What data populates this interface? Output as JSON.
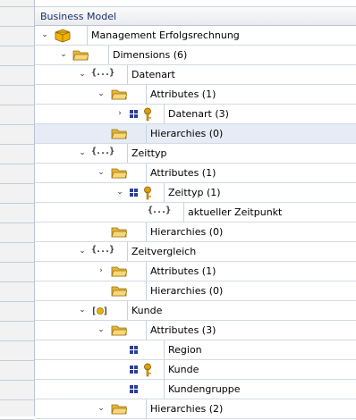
{
  "header": {
    "title": "Business Model"
  },
  "tree": [
    {
      "label": "Management Erfolgsrechnung",
      "icon": "cube-icon",
      "toggle": "expanded",
      "selected": false
    },
    {
      "label": "Dimensions (6)",
      "icon": "folder-icon",
      "toggle": "expanded",
      "selected": false
    },
    {
      "label": "Datenart",
      "icon": "dimension-icon",
      "toggle": "expanded",
      "selected": false
    },
    {
      "label": "Attributes (1)",
      "icon": "folder-icon",
      "toggle": "expanded",
      "selected": false
    },
    {
      "label": "Datenart (3)",
      "icon": "key-attribute-icon",
      "toggle": "collapsed",
      "selected": false
    },
    {
      "label": "Hierarchies (0)",
      "icon": "folder-icon",
      "toggle": "none",
      "selected": true
    },
    {
      "label": "Zeittyp",
      "icon": "dimension-icon",
      "toggle": "expanded",
      "selected": false
    },
    {
      "label": "Attributes (1)",
      "icon": "folder-icon",
      "toggle": "expanded",
      "selected": false
    },
    {
      "label": "Zeittyp (1)",
      "icon": "key-attribute-icon",
      "toggle": "expanded",
      "selected": false
    },
    {
      "label": "aktueller Zeitpunkt",
      "icon": "dimension-icon",
      "toggle": "none",
      "selected": false
    },
    {
      "label": "Hierarchies (0)",
      "icon": "folder-icon",
      "toggle": "none",
      "selected": false
    },
    {
      "label": "Zeitvergleich",
      "icon": "dimension-icon",
      "toggle": "expanded",
      "selected": false
    },
    {
      "label": "Attributes (1)",
      "icon": "folder-icon",
      "toggle": "collapsed",
      "selected": false
    },
    {
      "label": "Hierarchies (0)",
      "icon": "folder-icon",
      "toggle": "none",
      "selected": false
    },
    {
      "label": "Kunde",
      "icon": "dimension-star-icon",
      "toggle": "expanded",
      "selected": false
    },
    {
      "label": "Attributes (3)",
      "icon": "folder-icon",
      "toggle": "expanded",
      "selected": false
    },
    {
      "label": "Region",
      "icon": "attribute-icon",
      "toggle": "none",
      "selected": false
    },
    {
      "label": "Kunde",
      "icon": "key-attribute-icon",
      "toggle": "none",
      "selected": false
    },
    {
      "label": "Kundengruppe",
      "icon": "attribute-icon",
      "toggle": "none",
      "selected": false
    },
    {
      "label": "Hierarchies (2)",
      "icon": "folder-icon",
      "toggle": "expanded",
      "selected": false
    }
  ],
  "colors": {
    "selection": "#e6ecf6",
    "header_text": "#1c2f6b",
    "folder": "#e7b43a",
    "cube": "#f0b400",
    "key": "#e0a000",
    "attribute": "#2a3f97"
  }
}
